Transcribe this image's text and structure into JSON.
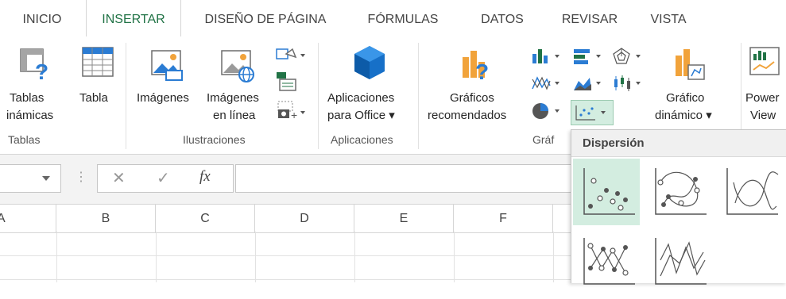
{
  "tabs": [
    "INICIO",
    "INSERTAR",
    "DISEÑO DE PÁGINA",
    "FÓRMULAS",
    "DATOS",
    "REVISAR",
    "VISTA"
  ],
  "ribbon": {
    "tablas_dinamicas": [
      "Tablas",
      "inámicas"
    ],
    "tabla": "Tabla",
    "imagenes": "Imágenes",
    "imagenes_linea": [
      "Imágenes",
      "en línea"
    ],
    "aplicaciones_office": [
      "Aplicaciones",
      "para Office ▾"
    ],
    "graficos_recomendados": [
      "Gráficos",
      "recomendados"
    ],
    "grafico_dinamico": [
      "Gráfico",
      "dinámico ▾"
    ],
    "power_view": [
      "Power",
      "View"
    ],
    "groups": {
      "tablas": "Tablas",
      "ilustraciones": "Ilustraciones",
      "aplicaciones": "Aplicaciones",
      "graficos": "Gráf"
    }
  },
  "formula_bar": {
    "fx": "fx",
    "cancel": "✕",
    "enter": "✓"
  },
  "columns": [
    "A",
    "B",
    "C",
    "D",
    "E",
    "F"
  ],
  "dropdown": {
    "title": "Dispersión"
  },
  "colors": {
    "accent": "#217346",
    "selected": "#d3ede0"
  }
}
